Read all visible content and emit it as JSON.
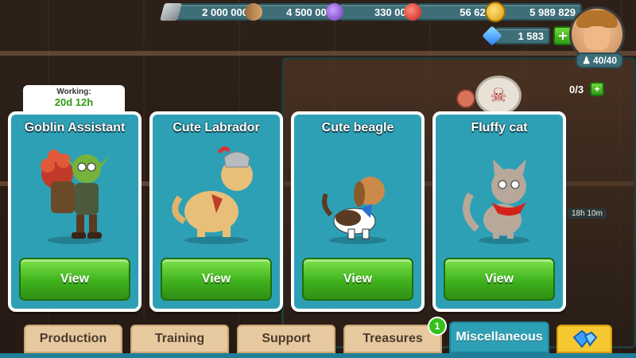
{
  "resources": {
    "iron": {
      "value": "2 000 000",
      "icon": "iron-ingot-icon"
    },
    "wood": {
      "value": "4 500 000",
      "icon": "wood-log-icon"
    },
    "potion": {
      "value": "330 000",
      "icon": "potion-icon"
    },
    "food": {
      "value": "56 620",
      "icon": "apple-icon"
    },
    "gold": {
      "value": "5 989 829",
      "icon": "gold-coin-icon"
    },
    "gems": {
      "value": "1 583",
      "icon": "gem-icon"
    }
  },
  "population": "40/40",
  "capacity_counter": "0/3",
  "side_timer": "18h 10m",
  "working": {
    "label": "Working:",
    "value": "20d 12h"
  },
  "cards": [
    {
      "title": "Goblin Assistant",
      "button": "View"
    },
    {
      "title": "Cute Labrador",
      "button": "View"
    },
    {
      "title": "Cute beagle",
      "button": "View"
    },
    {
      "title": "Fluffy cat",
      "button": "View"
    }
  ],
  "tabs": [
    {
      "label": "Production"
    },
    {
      "label": "Training"
    },
    {
      "label": "Support"
    },
    {
      "label": "Treasures"
    },
    {
      "label": "Miscellaneous"
    }
  ],
  "treasures_badge": "1",
  "colors": {
    "card": "#2da0b6",
    "button": "#3fb21d",
    "tab": "#e7c9a0",
    "tab_active": "#2da0b6"
  }
}
